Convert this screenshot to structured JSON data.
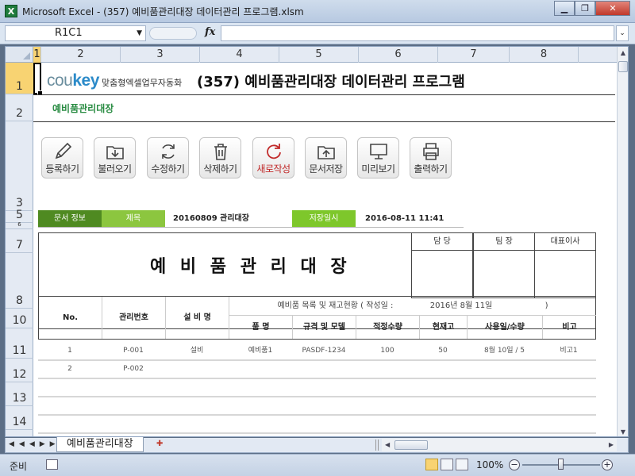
{
  "window": {
    "title": "Microsoft Excel - (357) 예비품관리대장 데이터관리 프로그램.xlsm",
    "app_icon": "X"
  },
  "formula_bar": {
    "name_box": "R1C1",
    "fx": "fx",
    "formula": ""
  },
  "columns": [
    "1",
    "2",
    "3",
    "4",
    "5",
    "6",
    "7",
    "8"
  ],
  "rows": [
    "1",
    "2",
    "3",
    "5",
    "6",
    "7",
    "8",
    "10",
    "11",
    "12",
    "13",
    "14"
  ],
  "header": {
    "brand_cou": "cou",
    "brand_key": "key",
    "brand_sub": "맞춤형엑셀업무자동화",
    "title": "(357) 예비품관리대장 데이터관리 프로그램",
    "sub_title": "예비품관리대장"
  },
  "toolbar": {
    "register": "등록하기",
    "load": "불러오기",
    "edit": "수정하기",
    "delete": "삭제하기",
    "new": "새로작성",
    "save_doc": "문서저장",
    "preview": "미리보기",
    "print": "출력하기"
  },
  "info": {
    "doc_info_label": "문서 정보",
    "subject_label": "제목",
    "subject_value": "20160809 관리대장",
    "saved_label": "저장일시",
    "saved_value": "2016-08-11 11:41"
  },
  "document": {
    "title": "예 비 품 관 리 대 장",
    "approvals": [
      "담 당",
      "팀 장",
      "대표이사"
    ]
  },
  "table": {
    "col_no": "No.",
    "col_mgmt": "관리번호",
    "col_equip": "설 비 명",
    "group_header": "예비품 목록 및 재고현황 ( 작성일 :",
    "group_date": "2016년 8월 11일",
    "group_close": ")",
    "sub_cols": [
      "품 명",
      "규격 및 모델",
      "적정수량",
      "현재고",
      "사용일/수량",
      "비고"
    ],
    "rows": [
      {
        "no": "1",
        "mgmt": "P-001",
        "equip": "설비",
        "item": "예비품1",
        "spec": "PASDF-1234",
        "qty": "100",
        "stock": "50",
        "used": "8월 10일 / 5",
        "note": "비고1"
      },
      {
        "no": "2",
        "mgmt": "P-002",
        "equip": "",
        "item": "",
        "spec": "",
        "qty": "",
        "stock": "",
        "used": "",
        "note": ""
      }
    ]
  },
  "sheet_tabs": {
    "active": "예비품관리대장"
  },
  "status": {
    "ready": "준비",
    "zoom": "100%"
  }
}
